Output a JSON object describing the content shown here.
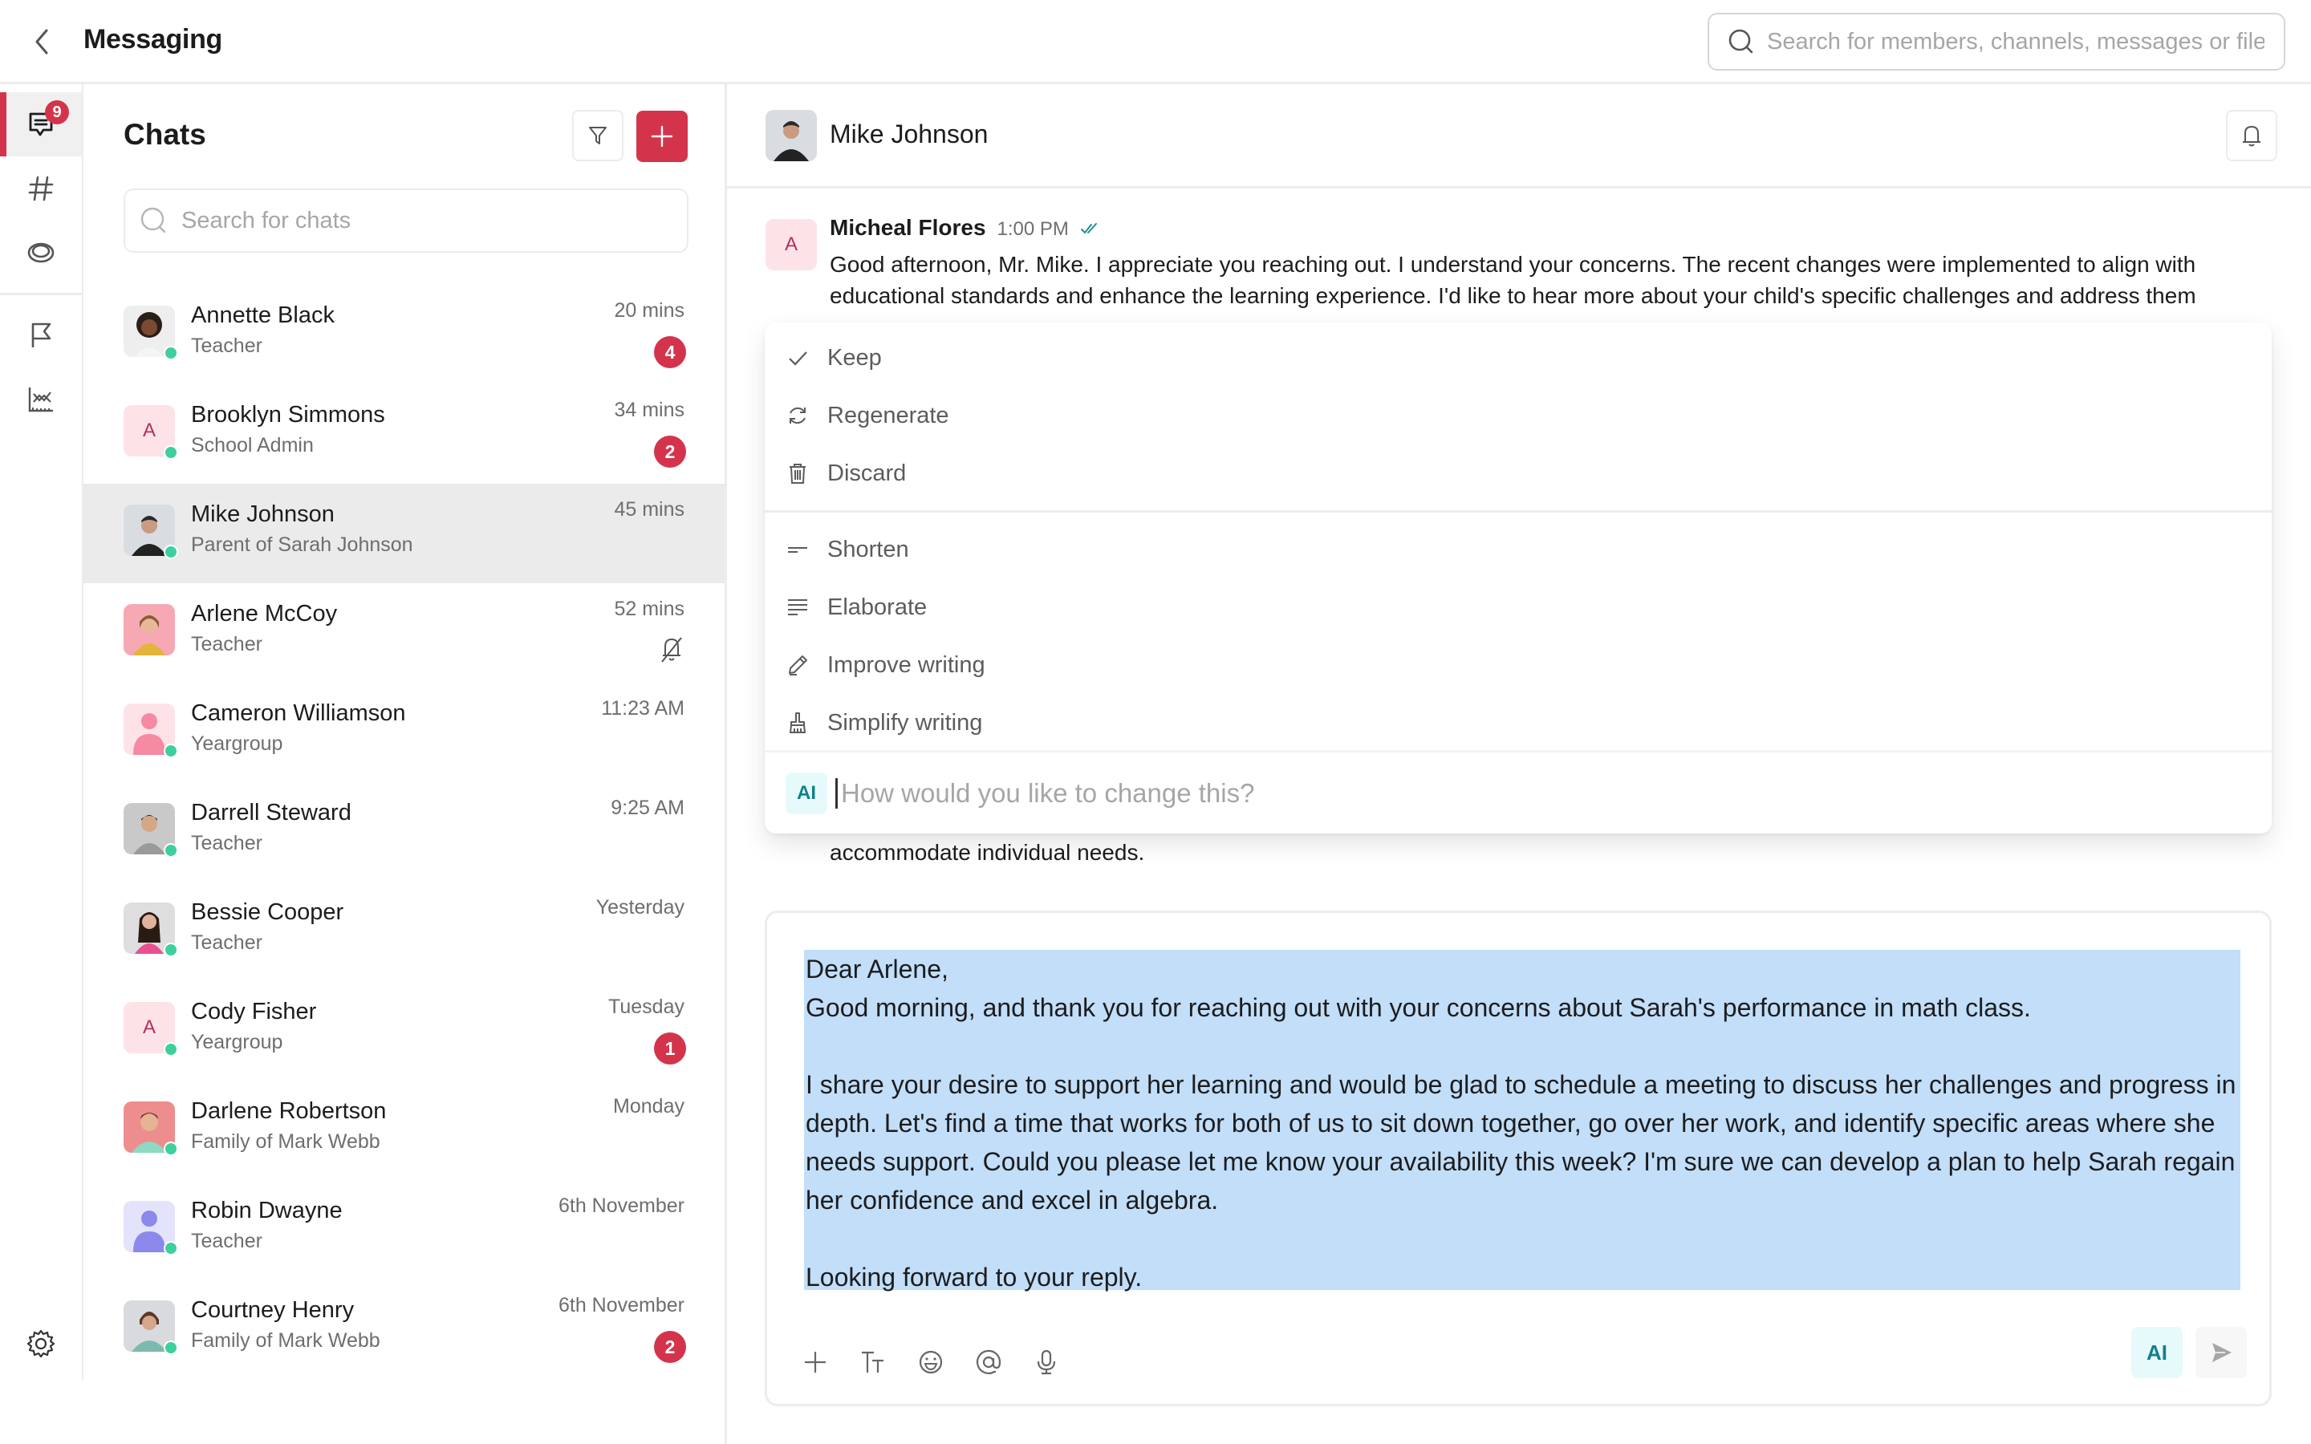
{
  "app": {
    "title": "Messaging",
    "global_search_placeholder": "Search for members, channels, messages or files"
  },
  "rail": {
    "items": [
      {
        "icon": "chat-icon",
        "label": "Chats",
        "badge": "9",
        "active": true
      },
      {
        "icon": "hash-icon",
        "label": "Channels"
      },
      {
        "icon": "eye-icon",
        "label": "Watching"
      },
      {
        "icon": "flag-icon",
        "label": "Flagged"
      },
      {
        "icon": "analytics-icon",
        "label": "Analytics"
      }
    ],
    "settings_icon": "gear-icon"
  },
  "chats": {
    "title": "Chats",
    "search_placeholder": "Search for chats",
    "items": [
      {
        "name": "Annette Black",
        "role": "Teacher",
        "time": "20 mins",
        "unread": "4",
        "avatar": "photo",
        "online": true
      },
      {
        "name": "Brooklyn Simmons",
        "role": "School Admin",
        "time": "34 mins",
        "unread": "2",
        "avatar": "initial",
        "initial": "A",
        "online": true
      },
      {
        "name": "Mike Johnson",
        "role": "Parent of Sarah Johnson",
        "time": "45 mins",
        "avatar": "photo",
        "online": true,
        "selected": true
      },
      {
        "name": "Arlene McCoy",
        "role": "Teacher",
        "time": "52 mins",
        "muted": true,
        "avatar": "photo"
      },
      {
        "name": "Cameron Williamson",
        "role": "Yeargroup",
        "time": "11:23 AM",
        "avatar": "person-pink",
        "online": true
      },
      {
        "name": "Darrell Steward",
        "role": "Teacher",
        "time": "9:25 AM",
        "avatar": "photo",
        "online": true
      },
      {
        "name": "Bessie Cooper",
        "role": "Teacher",
        "time": "Yesterday",
        "avatar": "photo",
        "online": true
      },
      {
        "name": "Cody Fisher",
        "role": "Yeargroup",
        "time": "Tuesday",
        "unread": "1",
        "avatar": "initial",
        "initial": "A",
        "online": true
      },
      {
        "name": "Darlene Robertson",
        "role": "Family of Mark Webb",
        "time": "Monday",
        "avatar": "photo",
        "online": true
      },
      {
        "name": "Robin Dwayne",
        "role": "Teacher",
        "time": "6th November",
        "avatar": "person-purple",
        "online": true
      },
      {
        "name": "Courtney Henry",
        "role": "Family of Mark Webb",
        "time": "6th November",
        "unread": "2",
        "avatar": "photo",
        "online": true
      }
    ]
  },
  "conversation": {
    "contact_name": "Mike Johnson",
    "message": {
      "author": "Micheal Flores",
      "author_initial": "A",
      "time": "1:00 PM",
      "status": "read",
      "body": "Good afternoon, Mr. Mike. I appreciate you reaching out. I understand your concerns. The recent changes were implemented to align with educational standards and enhance the learning experience. I'd like to hear more about your child's specific challenges and address them",
      "tail": "accommodate individual needs."
    }
  },
  "ai_menu": {
    "items_primary": [
      {
        "icon": "check-icon",
        "label": "Keep"
      },
      {
        "icon": "refresh-icon",
        "label": "Regenerate"
      },
      {
        "icon": "trash-icon",
        "label": "Discard"
      }
    ],
    "items_secondary": [
      {
        "icon": "shorten-icon",
        "label": "Shorten"
      },
      {
        "icon": "elaborate-icon",
        "label": "Elaborate"
      },
      {
        "icon": "pencil-icon",
        "label": "Improve writing"
      },
      {
        "icon": "brush-icon",
        "label": "Simplify writing"
      }
    ],
    "ai_tag": "AI",
    "prompt_placeholder": "How would you like to change this?"
  },
  "composer": {
    "text": "Dear Arlene,\nGood morning, and thank you for reaching out with your concerns about Sarah's performance in math class.\n\nI share your desire to support her learning and would be glad to schedule a meeting to discuss her challenges and progress in depth. Let's find a time that works for both of us to sit down together, go over her work, and identify specific areas where she needs support. Could you please let me know your availability this week? I'm sure we can develop a plan to help Sarah regain her confidence and excel in algebra.\n\nLooking forward to your reply.",
    "tools": [
      "plus-icon",
      "text-format-icon",
      "emoji-icon",
      "mention-icon",
      "microphone-icon"
    ],
    "ai_button": "AI",
    "send_icon": "send-icon"
  },
  "colors": {
    "accent_red": "#d4344b",
    "online_green": "#3ecf9e",
    "selection_blue": "#c2def8",
    "ai_teal": "#11808a",
    "ai_bg": "#e6fafc"
  }
}
